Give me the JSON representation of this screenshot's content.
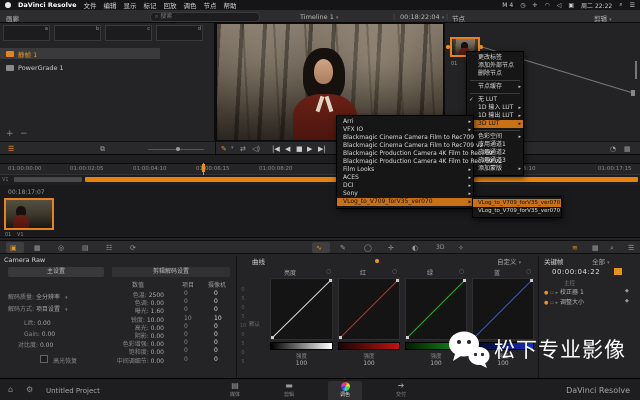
{
  "menubar": {
    "app_name": "DaVinci Resolve",
    "menus": [
      "文件",
      "编辑",
      "显示",
      "标记",
      "回放",
      "调色",
      "节点",
      "帮助"
    ],
    "input_indicator": "M 4",
    "clock": "周二 22:22"
  },
  "toolbar": {
    "gallery_label": "画廊",
    "search_placeholder": "搜索",
    "timeline_name": "Timeline 1",
    "timecode": "00:18:22:04",
    "nodes_label": "节点",
    "clip_dropdown": "剪辑"
  },
  "gallery": {
    "slots": [
      "a",
      "b",
      "c",
      "d"
    ],
    "albums": [
      {
        "label": "静帧 1"
      },
      {
        "label": "PowerGrade 1"
      }
    ]
  },
  "node_graph": {
    "node_label": "01"
  },
  "context_menu": {
    "items": [
      {
        "label": "更改标签"
      },
      {
        "label": "添加外部节点"
      },
      {
        "label": "删除节点",
        "sep": true
      },
      {
        "label": "节点缓存",
        "arrow": true,
        "sep": true
      },
      {
        "label": "无 LUT",
        "check": true
      },
      {
        "label": "1D 输入 LUT",
        "arrow": true
      },
      {
        "label": "1D 输出 LUT",
        "arrow": true
      },
      {
        "label": "3D LUT",
        "arrow": true,
        "hl": true,
        "sep": true
      },
      {
        "label": "色彩空间",
        "arrow": true
      },
      {
        "label": "应用通道1",
        "check": true
      },
      {
        "label": "应用通道2",
        "check": true
      },
      {
        "label": "应用通道3",
        "check": true
      },
      {
        "label": "添加蒙版",
        "arrow": true
      }
    ]
  },
  "lut_menu": {
    "items": [
      {
        "label": "Arri",
        "arrow": true
      },
      {
        "label": "VFX IO",
        "arrow": true
      },
      {
        "label": "Blackmagic Cinema Camera Film to Rec709"
      },
      {
        "label": "Blackmagic Cinema Camera Film to Rec709 v2"
      },
      {
        "label": "Blackmagic Production Camera 4K Film to Rec709"
      },
      {
        "label": "Blackmagic Production Camera 4K Film to Rec709 v2"
      },
      {
        "label": "Film Looks",
        "arrow": true
      },
      {
        "label": "ACES",
        "arrow": true
      },
      {
        "label": "DCI",
        "arrow": true
      },
      {
        "label": "Sony",
        "arrow": true
      },
      {
        "label": "VLog_to_V709_forV35_ver070",
        "arrow": true,
        "hl": true
      }
    ]
  },
  "lut_submenu": {
    "items": [
      {
        "label": "VLog_to_V709_forV35_ver070",
        "hl": true
      },
      {
        "label": "VLog_to_V709_forV35_ver070"
      }
    ]
  },
  "timeline": {
    "ruler_ticks": [
      "01:00:00:00",
      "01:00:02:05",
      "01:00:04:10",
      "01:00:06:15",
      "01:00:08:20",
      "01:00:15:10",
      "01:00:17:15"
    ],
    "track_label": "V1",
    "clip_timecode": "00:18:17:07",
    "clip_number": "01",
    "clip_version": "V1"
  },
  "camera_raw": {
    "title": "Camera Raw",
    "tabs": [
      "主设置",
      "剪辑解码设置"
    ],
    "decode_quality_label": "解码质量",
    "decode_quality": "全分辨率",
    "decode_mode_label": "解码方式",
    "decode_mode": "项目设置",
    "lift_label": "Lift",
    "lift": "0.00",
    "gain_label": "Gain",
    "gain": "0.00",
    "contrast_label": "对比度",
    "contrast": "0.00",
    "checkbox_label": "高光恢复",
    "table": {
      "headers": [
        "数值",
        "项目",
        "摄像机"
      ],
      "rows": [
        {
          "label": "色温",
          "value": "2500",
          "project": "0",
          "camera": "0"
        },
        {
          "label": "色调",
          "value": "0.00",
          "project": "0",
          "camera": "0"
        },
        {
          "label": "曝光",
          "value": "1.60",
          "project": "0",
          "camera": "0"
        },
        {
          "label": "锐度",
          "value": "10.00",
          "project": "10",
          "camera": "10"
        },
        {
          "label": "高光",
          "value": "0.00",
          "project": "0",
          "camera": "0"
        },
        {
          "label": "阴影",
          "value": "0.00",
          "project": "0",
          "camera": "0"
        },
        {
          "label": "色彩增强",
          "value": "0.00",
          "project": "0",
          "camera": "0"
        },
        {
          "label": "饱和度",
          "value": "0.00",
          "project": "0",
          "camera": "0"
        },
        {
          "label": "中间调细节",
          "value": "0.00",
          "project": "0",
          "camera": "0"
        }
      ]
    }
  },
  "curves": {
    "title": "曲线",
    "mode": "自定义",
    "default_label": "默认",
    "strength_label": "强度",
    "channels": [
      {
        "label": "亮度",
        "color": "#d8d8d8",
        "strength": "100"
      },
      {
        "label": "红",
        "color": "#d02a2a",
        "strength": "100"
      },
      {
        "label": "绿",
        "color": "#2fae3a",
        "strength": "100"
      },
      {
        "label": "蓝",
        "color": "#3a55d8",
        "strength": "100"
      }
    ]
  },
  "keyframes": {
    "title": "关键帧",
    "scope": "全部",
    "timecode": "00:00:04:22",
    "master_label": "主控",
    "rows": [
      {
        "label": "校正器 1"
      },
      {
        "label": "调整大小"
      }
    ]
  },
  "bottom_bar": {
    "project_name": "Untitled Project",
    "brand": "DaVinci Resolve",
    "pages": [
      {
        "label": "媒体"
      },
      {
        "label": "剪辑"
      },
      {
        "label": "调色",
        "active": true
      },
      {
        "label": "交付"
      }
    ]
  },
  "watermark": {
    "text": "松下专业影像"
  },
  "colors": {
    "accent": "#e8821e",
    "menu_highlight": "#c97117",
    "timeline_bar": "#e8820c",
    "curve_red": "#d02a2a",
    "curve_green": "#2fae3a",
    "curve_blue": "#3a55d8",
    "curve_luma": "#d8d8d8"
  }
}
